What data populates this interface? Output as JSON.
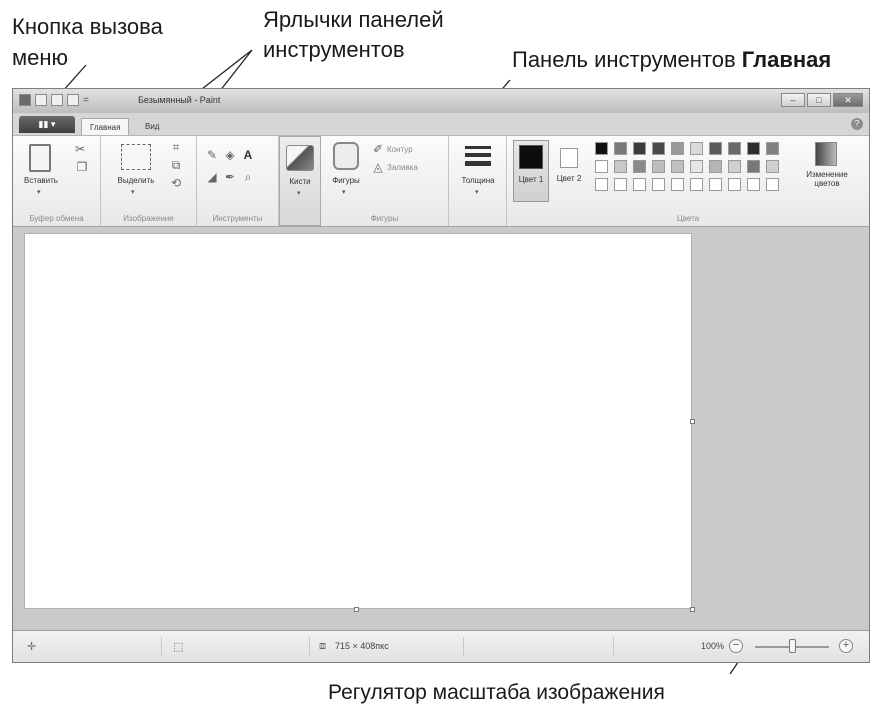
{
  "callouts": {
    "menu_button_l1": "Кнопка вызова",
    "menu_button_l2": "меню",
    "tabs_l1": "Ярлычки панелей",
    "tabs_l2": "инструментов",
    "home_toolbar_prefix": "Панель инструментов",
    "home_toolbar_bold": "Главная",
    "zoom_regulator": "Регулятор масштаба изображения"
  },
  "window": {
    "title": "Безымянный - Paint",
    "menu_button_glyph": "▮▮ ▾",
    "help_glyph": "?"
  },
  "tabs": [
    {
      "label": "Главная",
      "active": true
    },
    {
      "label": "Вид",
      "active": false
    }
  ],
  "ribbon": {
    "clipboard": {
      "paste_label": "Вставить",
      "group_label": "Буфер обмена"
    },
    "image": {
      "select_label": "Выделить",
      "group_label": "Изображение"
    },
    "tools": {
      "group_label": "Инструменты"
    },
    "brushes": {
      "label": "Кисти"
    },
    "shapes": {
      "shapes_label": "Фигуры",
      "outline_label": "Контур",
      "fill_label": "Заливка",
      "group_label": "Фигуры"
    },
    "size": {
      "label": "Толщина"
    },
    "colors": {
      "color1_label": "Цвет 1",
      "color2_label": "Цвет 2",
      "edit_label": "Изменение цветов",
      "group_label": "Цвета",
      "palette_row1": [
        "#111111",
        "#7a7a7a",
        "#3a3a3a",
        "#4a4a4a",
        "#9a9a9a",
        "#d9d9d9",
        "#5a5a5a",
        "#6a6a6a",
        "#2e2e2e",
        "#808080"
      ],
      "palette_row2": [
        "#ffffff",
        "#c8c8c8",
        "#8a8a8a",
        "#bdbdbd",
        "#c0c0c0",
        "#e6e6e6",
        "#b5b5b5",
        "#d0d0d0",
        "#777777",
        "#cfcfcf"
      ],
      "palette_row3": [
        "#ffffff",
        "#ffffff",
        "#ffffff",
        "#ffffff",
        "#ffffff",
        "#ffffff",
        "#ffffff",
        "#ffffff",
        "#ffffff",
        "#ffffff"
      ]
    }
  },
  "status": {
    "image_size": "715 × 408пкс",
    "zoom": "100%"
  }
}
